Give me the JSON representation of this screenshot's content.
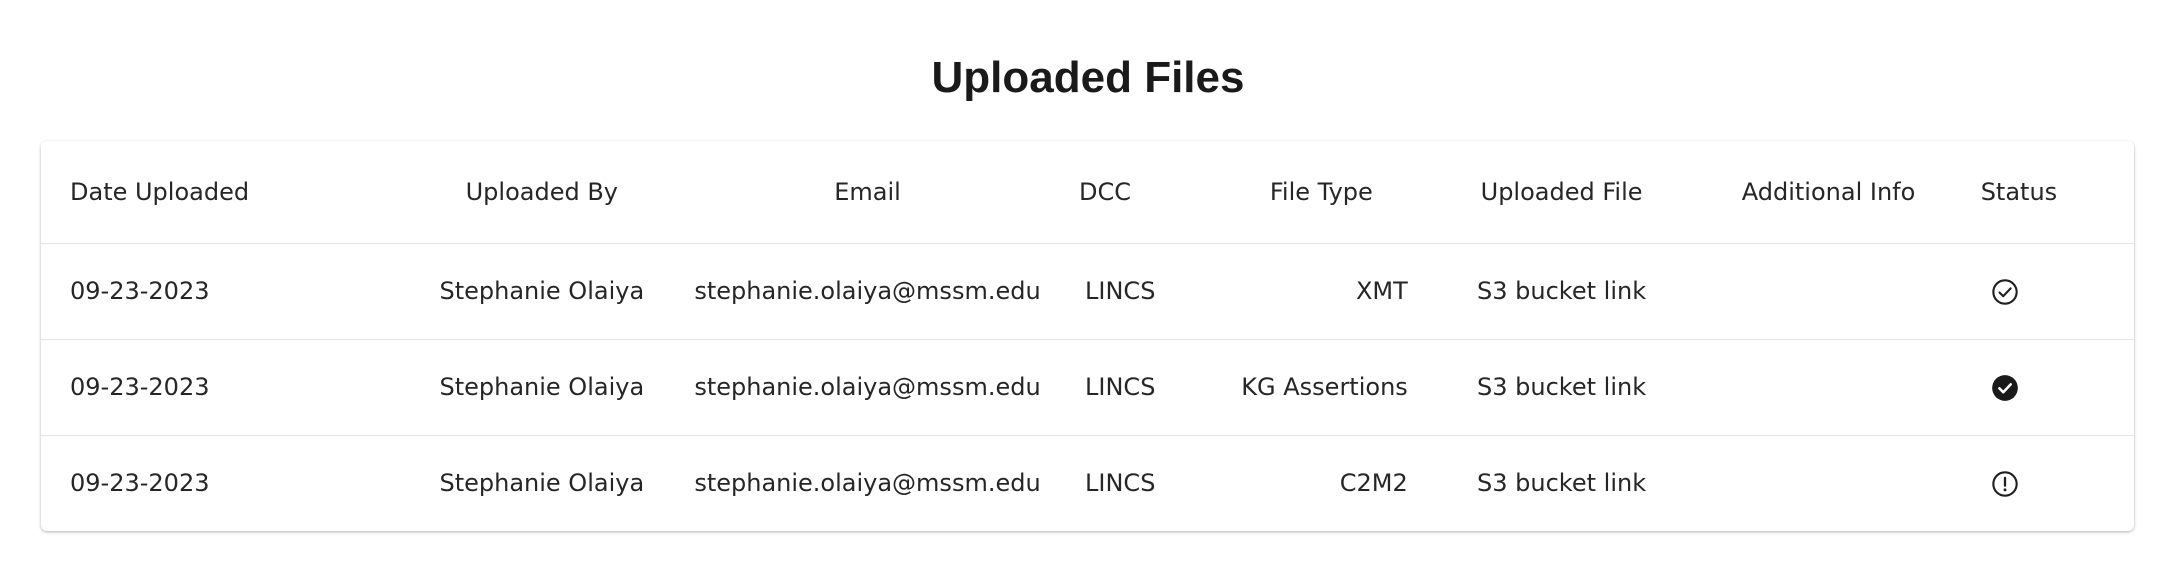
{
  "page": {
    "title": "Uploaded Files"
  },
  "table": {
    "headers": {
      "date": "Date Uploaded",
      "uploaded_by": "Uploaded By",
      "email": "Email",
      "dcc": "DCC",
      "file_type": "File Type",
      "uploaded_file": "Uploaded File",
      "additional_info": "Additional Info",
      "status": "Status"
    },
    "rows": [
      {
        "date": "09-23-2023",
        "uploaded_by": "Stephanie Olaiya",
        "email": "stephanie.olaiya@mssm.edu",
        "dcc": "LINCS",
        "file_type": "XMT",
        "uploaded_file": "S3 bucket link",
        "additional_info": "",
        "status_icon": "check-circle-outline-icon"
      },
      {
        "date": "09-23-2023",
        "uploaded_by": "Stephanie Olaiya",
        "email": "stephanie.olaiya@mssm.edu",
        "dcc": "LINCS",
        "file_type": "KG Assertions",
        "uploaded_file": "S3 bucket link",
        "additional_info": "",
        "status_icon": "check-circle-filled-icon"
      },
      {
        "date": "09-23-2023",
        "uploaded_by": "Stephanie Olaiya",
        "email": "stephanie.olaiya@mssm.edu",
        "dcc": "LINCS",
        "file_type": "C2M2",
        "uploaded_file": "S3 bucket link",
        "additional_info": "",
        "status_icon": "error-outline-icon"
      }
    ]
  }
}
